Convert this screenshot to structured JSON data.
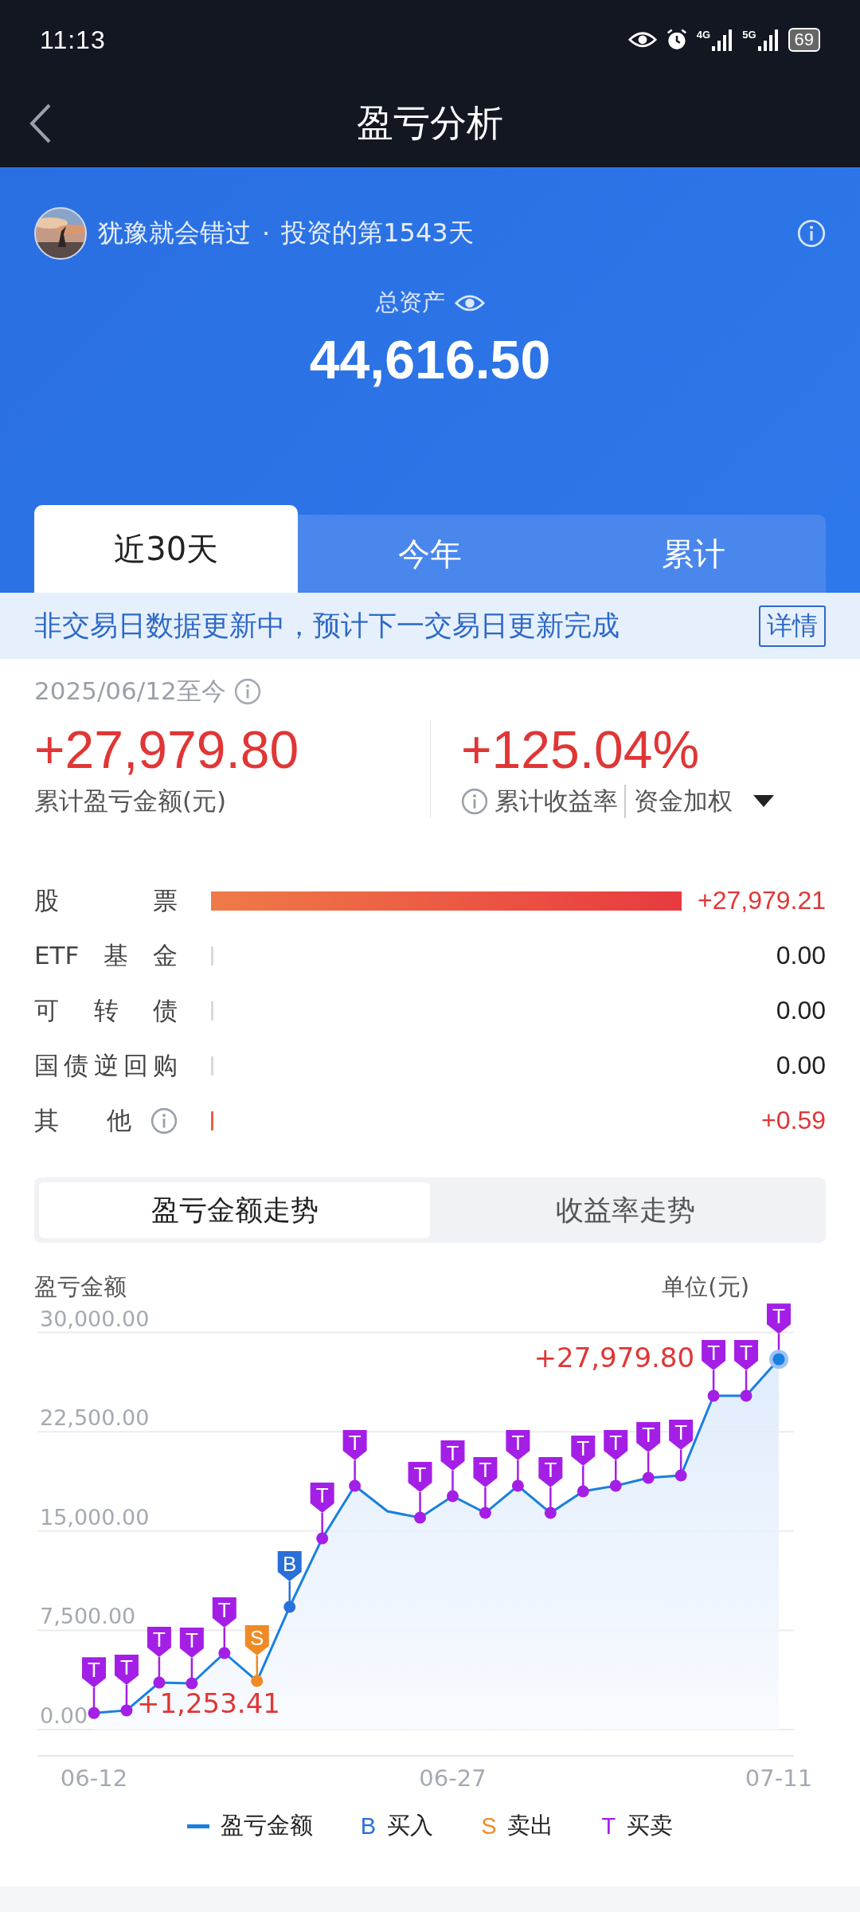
{
  "status_bar": {
    "time": "11:13",
    "signals": [
      {
        "label": "4G"
      },
      {
        "label": "5G"
      }
    ],
    "battery": "69"
  },
  "header": {
    "title": "盈亏分析"
  },
  "profile": {
    "name": "犹豫就会错过",
    "separator": "·",
    "days": "投资的第1543天"
  },
  "assets": {
    "label": "总资产",
    "value": "44,616.50"
  },
  "period_tabs": [
    {
      "label": "近30天",
      "selected": true
    },
    {
      "label": "今年",
      "selected": false
    },
    {
      "label": "累计",
      "selected": false
    }
  ],
  "notice": {
    "text": "非交易日数据更新中，预计下一交易日更新完成",
    "button": "详情"
  },
  "summary": {
    "range": "2025/06/12至今",
    "amount": "+27,979.80",
    "amount_label": "累计盈亏金额(元)",
    "rate": "+125.04%",
    "rate_label": "累计收益率",
    "weighting": "资金加权"
  },
  "breakdown": [
    {
      "label": "股票",
      "value": "+27,979.21",
      "kind": "major",
      "info": false
    },
    {
      "label": "ETF基金",
      "value": "0.00",
      "kind": "zero",
      "info": false
    },
    {
      "label": "可转债",
      "value": "0.00",
      "kind": "zero",
      "info": false
    },
    {
      "label": "国债逆回购",
      "value": "0.00",
      "kind": "zero",
      "info": false
    },
    {
      "label": "其他",
      "value": "+0.59",
      "kind": "minor",
      "info": true
    }
  ],
  "chart_tabs": [
    {
      "label": "盈亏金额走势",
      "selected": true
    },
    {
      "label": "收益率走势",
      "selected": false
    }
  ],
  "chart": {
    "ylabel": "盈亏金额",
    "unit": "单位(元)",
    "chart_data": {
      "type": "area",
      "grid": true,
      "categories": [
        "06-12",
        null,
        null,
        null,
        null,
        null,
        null,
        null,
        null,
        null,
        null,
        "06-27",
        null,
        null,
        null,
        null,
        null,
        null,
        null,
        null,
        null,
        "07-11"
      ],
      "series": [
        {
          "name": "盈亏金额",
          "color": "#1a7fe0",
          "values": [
            1250,
            1450,
            3550,
            3490,
            5780,
            3670,
            9270,
            14450,
            18420,
            16490,
            16010,
            17640,
            16370,
            18420,
            16370,
            18000,
            18420,
            19020,
            19200,
            25220,
            25220,
            27980
          ]
        }
      ],
      "ylim": [
        0,
        30000
      ],
      "yticks": [
        {
          "value": 0,
          "label": "0.00"
        },
        {
          "value": 7500,
          "label": "7,500.00"
        },
        {
          "value": 15000,
          "label": "15,000.00"
        },
        {
          "value": 22500,
          "label": "22,500.00"
        },
        {
          "value": 30000,
          "label": "30,000.00"
        }
      ],
      "annotations": [
        "+1,253.41",
        "+27,979.80"
      ]
    },
    "markers": [
      {
        "kind": "trade",
        "label": "T"
      },
      {
        "kind": "trade",
        "label": "T"
      },
      {
        "kind": "trade",
        "label": "T"
      },
      {
        "kind": "trade",
        "label": "T"
      },
      {
        "kind": "trade",
        "label": "T"
      },
      {
        "kind": "sell",
        "label": "S"
      },
      {
        "kind": "buy",
        "label": "B"
      },
      {
        "kind": "trade",
        "label": "T"
      },
      {
        "kind": "trade",
        "label": "T"
      },
      {
        "kind": "none"
      },
      {
        "kind": "trade",
        "label": "T"
      },
      {
        "kind": "trade",
        "label": "T"
      },
      {
        "kind": "trade",
        "label": "T"
      },
      {
        "kind": "trade",
        "label": "T"
      },
      {
        "kind": "trade",
        "label": "T"
      },
      {
        "kind": "trade",
        "label": "T"
      },
      {
        "kind": "trade",
        "label": "T"
      },
      {
        "kind": "trade",
        "label": "T"
      },
      {
        "kind": "trade",
        "label": "T"
      },
      {
        "kind": "trade",
        "label": "T"
      },
      {
        "kind": "trade",
        "label": "T"
      },
      {
        "kind": "trade",
        "label": "T"
      }
    ],
    "legend": [
      {
        "kind": "line"
      },
      {
        "kind": "buy",
        "symbol": "B",
        "label": "买入"
      },
      {
        "kind": "sell",
        "symbol": "S",
        "label": "卖出"
      },
      {
        "kind": "trade",
        "symbol": "T",
        "label": "买卖"
      }
    ]
  }
}
